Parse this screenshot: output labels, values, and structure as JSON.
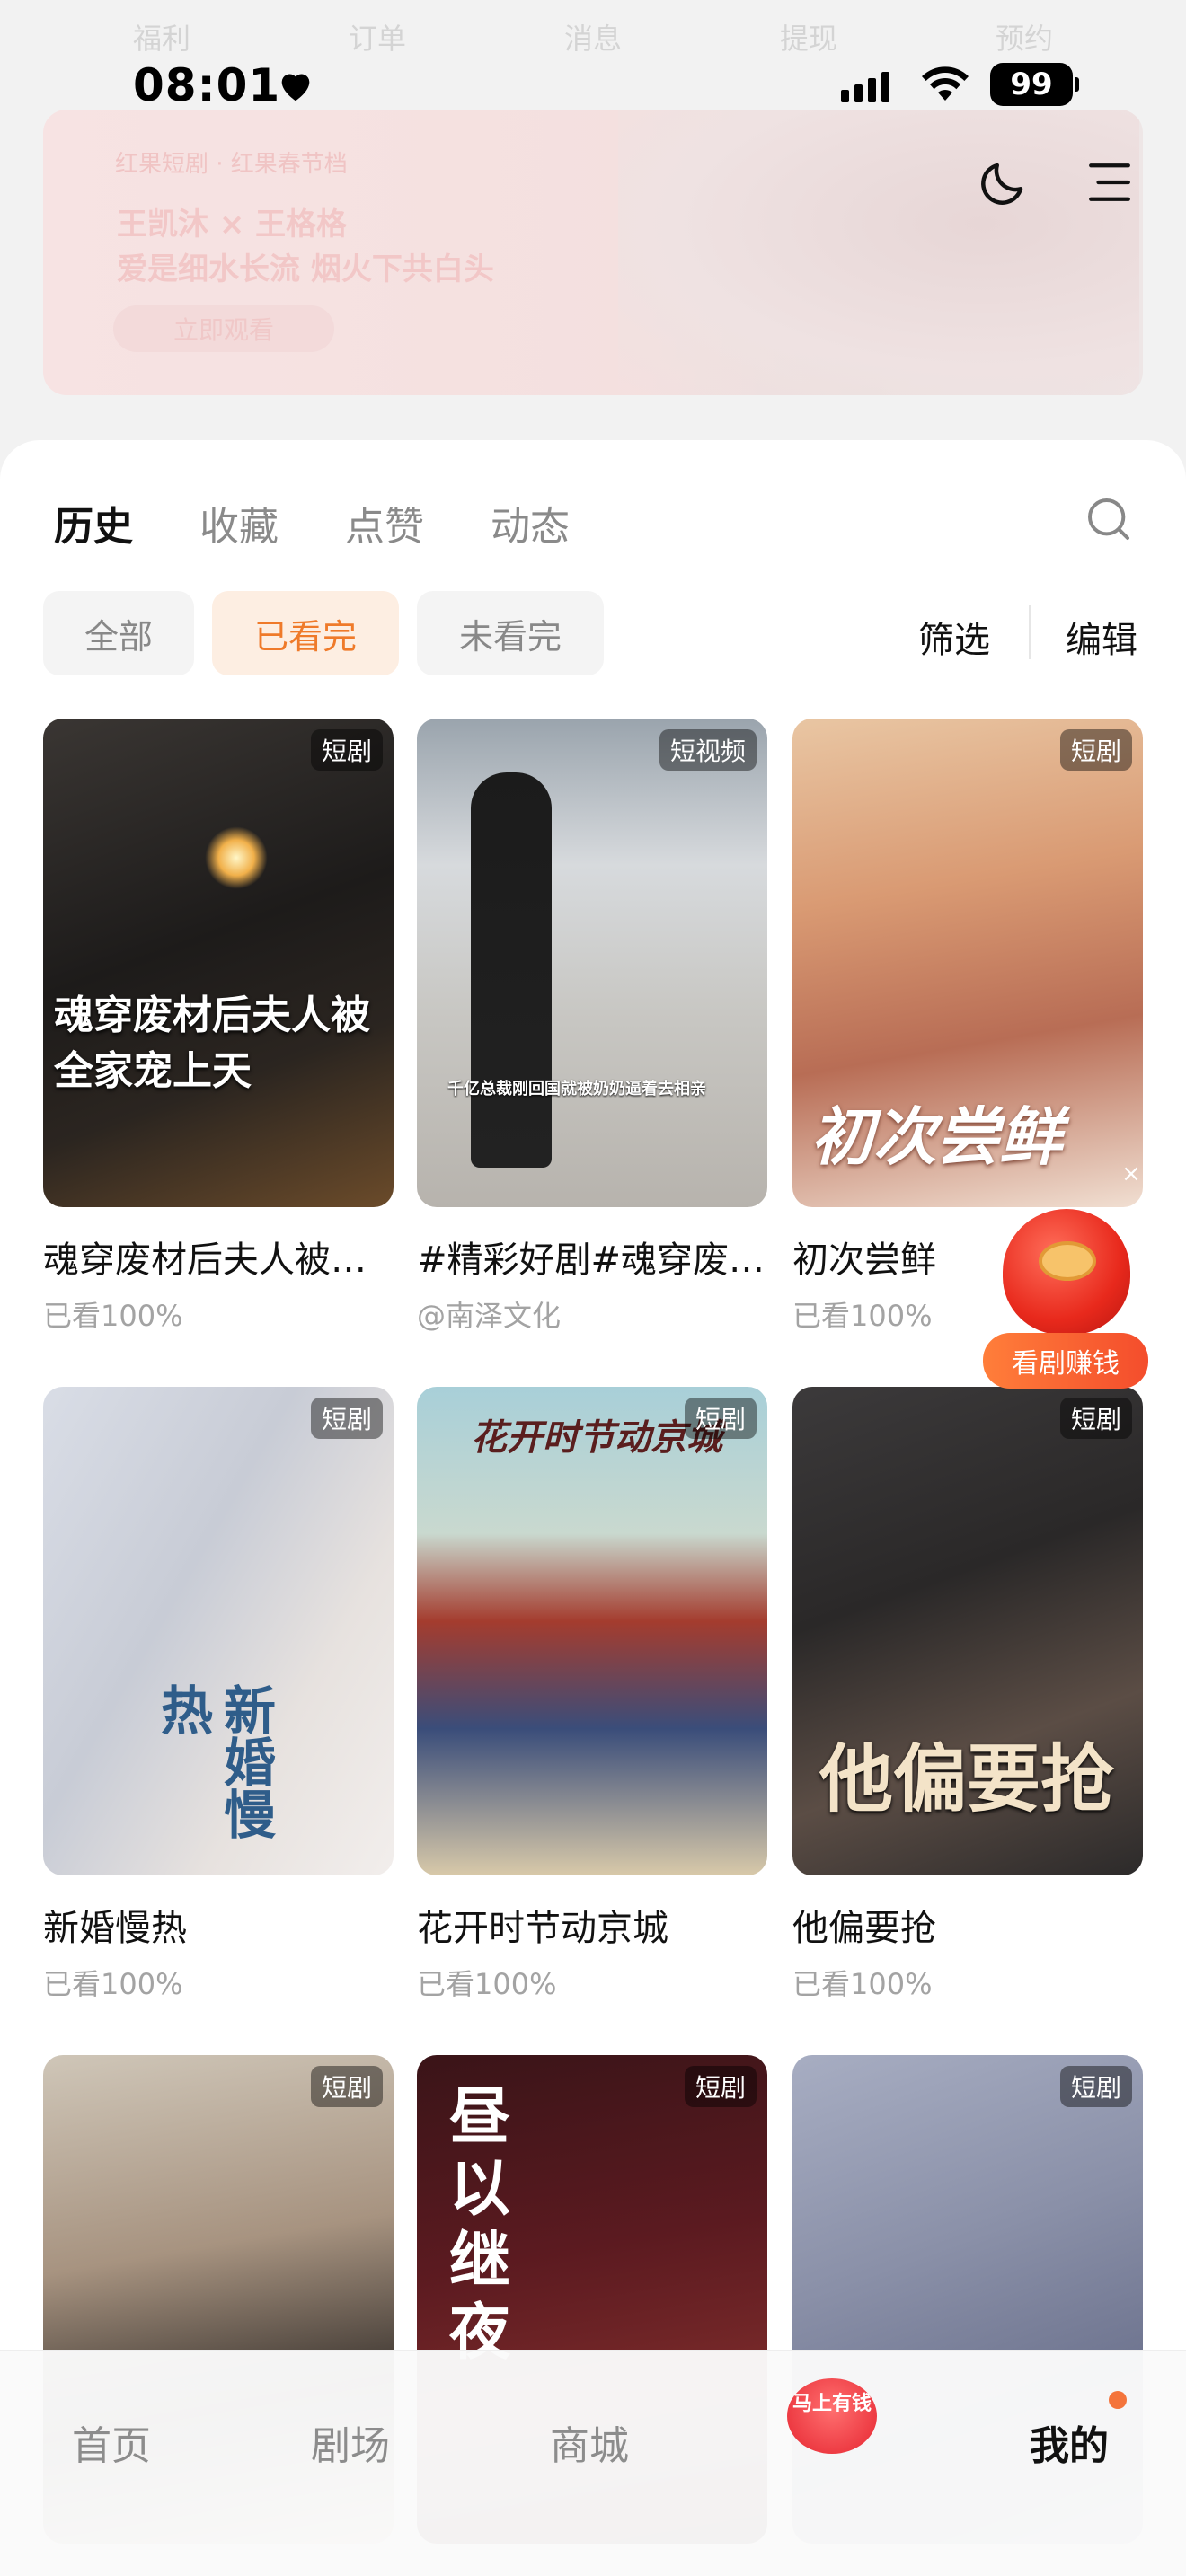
{
  "faded_tabs": [
    "福利",
    "订单",
    "消息",
    "提现",
    "预约"
  ],
  "status": {
    "time": "08:01",
    "battery": "99"
  },
  "banner": {
    "brand": "红果短剧 · 红果春节档",
    "line1": "王凯沐 × 王格格",
    "line2": "爱是细水长流 烟火下共白头",
    "button": "立即观看"
  },
  "tabs": [
    {
      "label": "历史",
      "active": true
    },
    {
      "label": "收藏",
      "active": false
    },
    {
      "label": "点赞",
      "active": false
    },
    {
      "label": "动态",
      "active": false
    }
  ],
  "filters": {
    "all": "全部",
    "watched": "已看完",
    "unwatched": "未看完",
    "filter": "筛选",
    "edit": "编辑"
  },
  "cards": [
    {
      "badge": "短剧",
      "title": "魂穿废材后夫人被全家宠上天",
      "sub": "已看100%",
      "poster_text": "魂穿废材后夫人被全家宠上天"
    },
    {
      "badge": "短视频",
      "title": "#精彩好剧#魂穿废材后夫人被全家宠上天",
      "sub": "@南泽文化",
      "poster_text": "千亿总裁刚回国就被奶奶逼着去相亲"
    },
    {
      "badge": "短剧",
      "title": "初次尝鲜",
      "sub": "已看100%",
      "poster_text": "初次尝鲜"
    },
    {
      "badge": "短剧",
      "title": "新婚慢热",
      "sub": "已看100%",
      "poster_text": "新婚慢热"
    },
    {
      "badge": "短剧",
      "title": "花开时节动京城",
      "sub": "已看100%",
      "poster_text": "花开时节动京城"
    },
    {
      "badge": "短剧",
      "title": "他偏要抢",
      "sub": "已看100%",
      "poster_text": "他偏要抢"
    },
    {
      "badge": "短剧",
      "title": "",
      "sub": "",
      "poster_text": ""
    },
    {
      "badge": "短剧",
      "title": "",
      "sub": "",
      "poster_text": "昼以继夜"
    },
    {
      "badge": "短剧",
      "title": "",
      "sub": "",
      "poster_text": ""
    }
  ],
  "reward": {
    "label": "看剧赚钱",
    "close": "×"
  },
  "bottom_nav": [
    {
      "label": "首页",
      "active": false
    },
    {
      "label": "剧场",
      "active": false
    },
    {
      "label": "商城",
      "active": false
    },
    {
      "label": "马上有钱",
      "active": false
    },
    {
      "label": "我的",
      "active": true
    }
  ]
}
